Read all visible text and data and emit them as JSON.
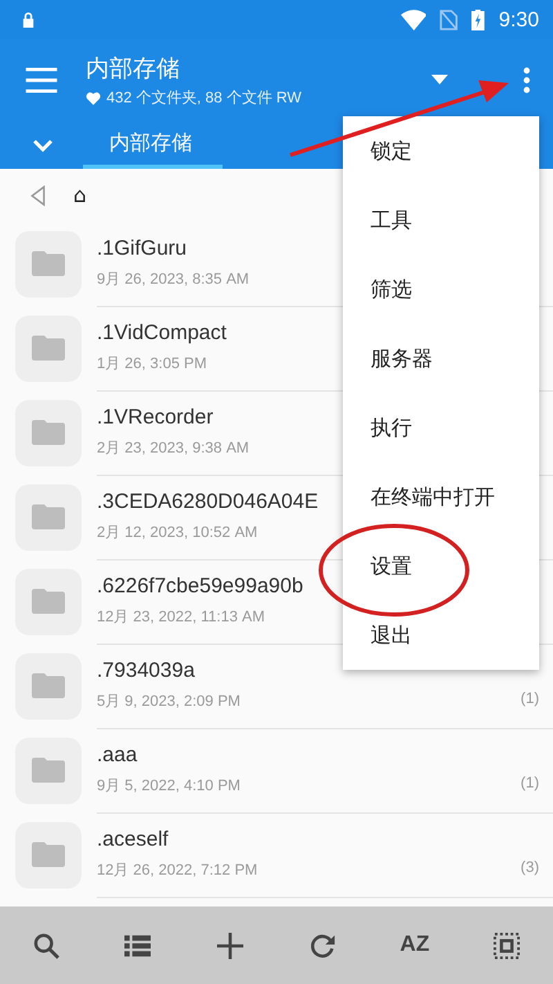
{
  "status_bar": {
    "time": "9:30"
  },
  "app_bar": {
    "title": "内部存储",
    "subtitle": "432 个文件夹, 88 个文件 RW"
  },
  "tabs": [
    {
      "label": "内部存储",
      "selected": true
    }
  ],
  "path": {
    "crumb": "⌂"
  },
  "files": [
    {
      "name": ".1GifGuru",
      "date": "9月 26, 2023, 8:35 AM"
    },
    {
      "name": ".1VidCompact",
      "date": "1月 26, 3:05 PM"
    },
    {
      "name": ".1VRecorder",
      "date": "2月 23, 2023, 9:38 AM"
    },
    {
      "name": ".3CEDA6280D046A04E",
      "date": "2月 12, 2023, 10:52 AM"
    },
    {
      "name": ".6226f7cbe59e99a90b",
      "date": "12月 23, 2022, 11:13 AM"
    },
    {
      "name": ".7934039a",
      "date": "5月 9, 2023, 2:09 PM",
      "count": "(1)"
    },
    {
      "name": ".aaa",
      "date": "9月 5, 2022, 4:10 PM",
      "count": "(1)"
    },
    {
      "name": ".aceself",
      "date": "12月 26, 2022, 7:12 PM",
      "count": "(3)"
    }
  ],
  "menu": {
    "items": [
      {
        "label": "锁定"
      },
      {
        "label": "工具"
      },
      {
        "label": "筛选"
      },
      {
        "label": "服务器"
      },
      {
        "label": "执行"
      },
      {
        "label": "在终端中打开"
      },
      {
        "label": "设置"
      },
      {
        "label": "退出"
      }
    ]
  },
  "toolbar": {
    "items": [
      {
        "kind": "search"
      },
      {
        "kind": "list"
      },
      {
        "kind": "add"
      },
      {
        "kind": "refresh"
      },
      {
        "kind": "text",
        "label": "AZ"
      },
      {
        "kind": "select"
      }
    ]
  }
}
